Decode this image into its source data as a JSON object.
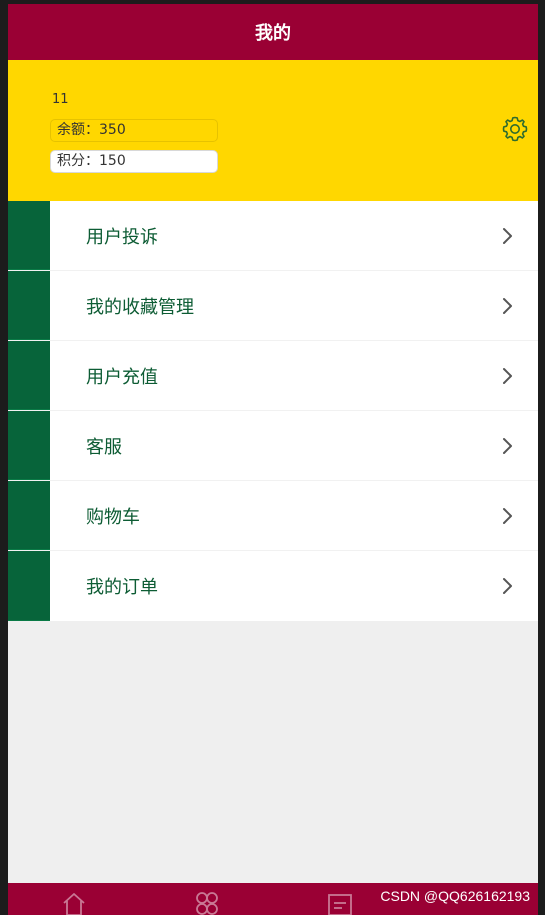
{
  "header": {
    "title": "我的"
  },
  "profile": {
    "user_id": "11",
    "balance_text": "余额：350",
    "points_text": "积分：150"
  },
  "icons": {
    "settings": "gear-icon",
    "chevron": "chevron-right-icon",
    "tabs": [
      "home-icon",
      "category-icon",
      "message-icon"
    ]
  },
  "menu": [
    {
      "label": "用户投诉"
    },
    {
      "label": "我的收藏管理"
    },
    {
      "label": "用户充值"
    },
    {
      "label": "客服"
    },
    {
      "label": "购物车"
    },
    {
      "label": "我的订单"
    }
  ],
  "watermark": "CSDN @QQ626162193",
  "colors": {
    "header": "#9a0034",
    "profile": "#ffd700",
    "accent": "#07643a",
    "background": "#efefef"
  }
}
